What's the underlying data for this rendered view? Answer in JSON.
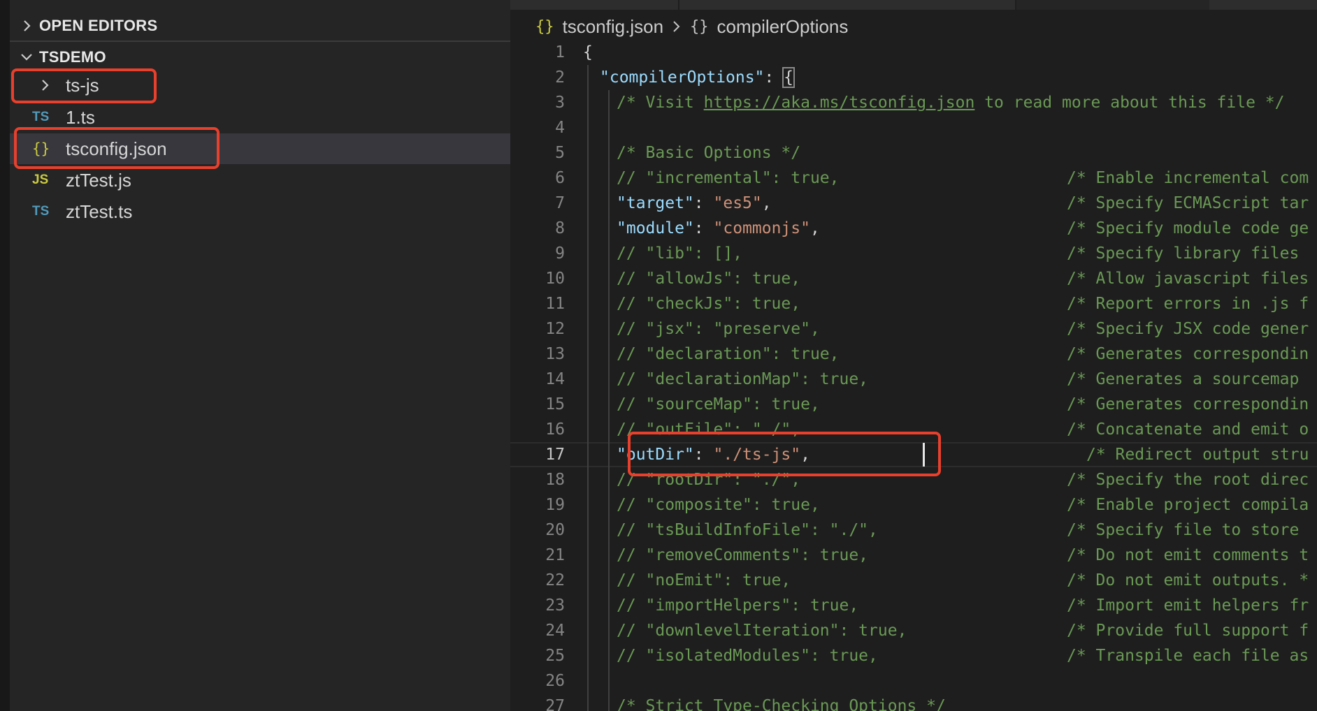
{
  "sidebar": {
    "open_editors_label": "OPEN EDITORS",
    "project_label": "TSDEMO",
    "items": [
      {
        "badge": "",
        "label": "ts-js",
        "kind": "folder"
      },
      {
        "badge": "TS",
        "label": "1.ts",
        "kind": "ts"
      },
      {
        "badge": "{}",
        "label": "tsconfig.json",
        "kind": "json"
      },
      {
        "badge": "JS",
        "label": "ztTest.js",
        "kind": "js"
      },
      {
        "badge": "TS",
        "label": "ztTest.ts",
        "kind": "ts"
      }
    ]
  },
  "breadcrumb": {
    "file_icon": "{}",
    "file": "tsconfig.json",
    "section_icon": "{}",
    "section": "compilerOptions"
  },
  "editor": {
    "lines": [
      {
        "n": "1",
        "left": "{",
        "right": ""
      },
      {
        "n": "2",
        "left": "\"compilerOptions\": {",
        "right": ""
      },
      {
        "n": "3",
        "left": "/* Visit https://aka.ms/tsconfig.json to read more about this file */",
        "right": ""
      },
      {
        "n": "4",
        "left": "",
        "right": ""
      },
      {
        "n": "5",
        "left": "/* Basic Options */",
        "right": ""
      },
      {
        "n": "6",
        "left": "// \"incremental\": true,",
        "right": "/* Enable incremental com"
      },
      {
        "n": "7",
        "left": "\"target\": \"es5\",",
        "right": "/* Specify ECMAScript tar"
      },
      {
        "n": "8",
        "left": "\"module\": \"commonjs\",",
        "right": "/* Specify module code ge"
      },
      {
        "n": "9",
        "left": "// \"lib\": [],",
        "right": "/* Specify library files"
      },
      {
        "n": "10",
        "left": "// \"allowJs\": true,",
        "right": "/* Allow javascript files"
      },
      {
        "n": "11",
        "left": "// \"checkJs\": true,",
        "right": "/* Report errors in .js f"
      },
      {
        "n": "12",
        "left": "// \"jsx\": \"preserve\",",
        "right": "/* Specify JSX code gener"
      },
      {
        "n": "13",
        "left": "// \"declaration\": true,",
        "right": "/* Generates correspondin"
      },
      {
        "n": "14",
        "left": "// \"declarationMap\": true,",
        "right": "/* Generates a sourcemap"
      },
      {
        "n": "15",
        "left": "// \"sourceMap\": true,",
        "right": "/* Generates correspondin"
      },
      {
        "n": "16",
        "left": "// \"outFile\": \"./\",",
        "right": "/* Concatenate and emit o"
      },
      {
        "n": "17",
        "left": "\"outDir\": \"./ts-js\",",
        "right": "/* Redirect output stru"
      },
      {
        "n": "18",
        "left": "// \"rootDir\": \"./\",",
        "right": "/* Specify the root direc"
      },
      {
        "n": "19",
        "left": "// \"composite\": true,",
        "right": "/* Enable project compila"
      },
      {
        "n": "20",
        "left": "// \"tsBuildInfoFile\": \"./\",",
        "right": "/* Specify file to store"
      },
      {
        "n": "21",
        "left": "// \"removeComments\": true,",
        "right": "/* Do not emit comments t"
      },
      {
        "n": "22",
        "left": "// \"noEmit\": true,",
        "right": "/* Do not emit outputs. *"
      },
      {
        "n": "23",
        "left": "// \"importHelpers\": true,",
        "right": "/* Import emit helpers fr"
      },
      {
        "n": "24",
        "left": "// \"downlevelIteration\": true,",
        "right": "/* Provide full support f"
      },
      {
        "n": "25",
        "left": "// \"isolatedModules\": true,",
        "right": "/* Transpile each file as"
      },
      {
        "n": "26",
        "left": "",
        "right": ""
      },
      {
        "n": "27",
        "left": "/* Strict Type-Checking Options */",
        "right": ""
      }
    ],
    "current_line": "17"
  },
  "colors": {
    "highlight_box": "#e8402c",
    "ts_badge": "#519aba",
    "js_badge": "#cbcb41",
    "json_key": "#9cdcfe",
    "json_string": "#ce9178",
    "comment": "#6a9955"
  }
}
